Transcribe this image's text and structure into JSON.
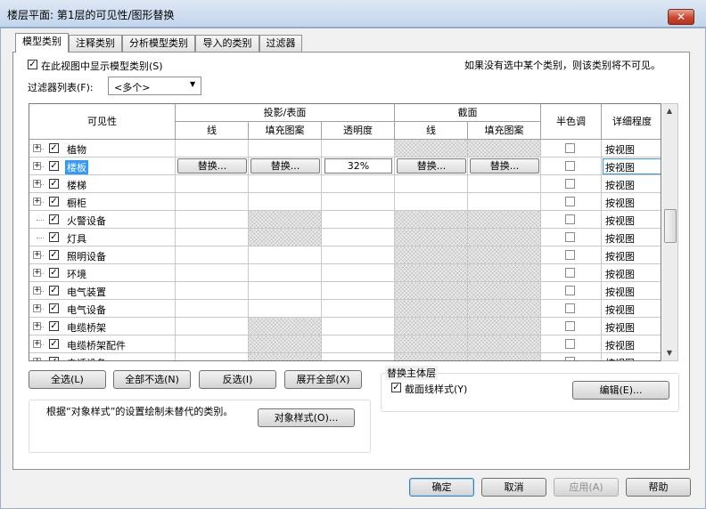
{
  "window": {
    "title": "楼层平面: 第1层的可见性/图形替换",
    "close_glyph": "✕"
  },
  "tabs": [
    "模型类别",
    "注释类别",
    "分析模型类别",
    "导入的类别",
    "过滤器"
  ],
  "show_categories": {
    "label": "在此视图中显示模型类别(S)",
    "checked": true
  },
  "hint": "如果没有选中某个类别，则该类别将不可见。",
  "filter_list": {
    "label": "过滤器列表(F):",
    "value": "<多个>"
  },
  "columns": {
    "visibility": "可见性",
    "projection_group": "投影/表面",
    "projection_line": "线",
    "projection_pattern": "填充图案",
    "transparency": "透明度",
    "cut_group": "截面",
    "cut_line": "线",
    "cut_pattern": "填充图案",
    "halftone": "半色调",
    "detail_level": "详细程度"
  },
  "rows": [
    {
      "name": "植物",
      "checked": true,
      "expandable": true,
      "selected": false,
      "proj_line_hatched": false,
      "proj_pattern_hatched": false,
      "cut_line_hatched": true,
      "cut_pattern_hatched": true,
      "detail": "按视图"
    },
    {
      "name": "楼板",
      "checked": true,
      "expandable": true,
      "selected": true,
      "proj_line_hatched": false,
      "proj_pattern_hatched": false,
      "cut_line_hatched": false,
      "cut_pattern_hatched": false,
      "detail": "按视图",
      "override_label": "替换...",
      "transparency": "32%"
    },
    {
      "name": "楼梯",
      "checked": true,
      "expandable": true,
      "selected": false,
      "proj_line_hatched": false,
      "proj_pattern_hatched": false,
      "cut_line_hatched": false,
      "cut_pattern_hatched": false,
      "detail": "按视图"
    },
    {
      "name": "橱柜",
      "checked": true,
      "expandable": true,
      "selected": false,
      "proj_line_hatched": false,
      "proj_pattern_hatched": false,
      "cut_line_hatched": false,
      "cut_pattern_hatched": false,
      "detail": "按视图"
    },
    {
      "name": "火警设备",
      "checked": true,
      "expandable": false,
      "selected": false,
      "proj_line_hatched": false,
      "proj_pattern_hatched": true,
      "cut_line_hatched": true,
      "cut_pattern_hatched": true,
      "detail": "按视图"
    },
    {
      "name": "灯具",
      "checked": true,
      "expandable": false,
      "selected": false,
      "proj_line_hatched": false,
      "proj_pattern_hatched": true,
      "cut_line_hatched": true,
      "cut_pattern_hatched": true,
      "detail": "按视图"
    },
    {
      "name": "照明设备",
      "checked": true,
      "expandable": true,
      "selected": false,
      "proj_line_hatched": false,
      "proj_pattern_hatched": false,
      "cut_line_hatched": true,
      "cut_pattern_hatched": true,
      "detail": "按视图"
    },
    {
      "name": "环境",
      "checked": true,
      "expandable": true,
      "selected": false,
      "proj_line_hatched": false,
      "proj_pattern_hatched": false,
      "cut_line_hatched": true,
      "cut_pattern_hatched": true,
      "detail": "按视图"
    },
    {
      "name": "电气装置",
      "checked": true,
      "expandable": true,
      "selected": false,
      "proj_line_hatched": false,
      "proj_pattern_hatched": false,
      "cut_line_hatched": true,
      "cut_pattern_hatched": true,
      "detail": "按视图"
    },
    {
      "name": "电气设备",
      "checked": true,
      "expandable": true,
      "selected": false,
      "proj_line_hatched": false,
      "proj_pattern_hatched": false,
      "cut_line_hatched": true,
      "cut_pattern_hatched": true,
      "detail": "按视图"
    },
    {
      "name": "电缆桥架",
      "checked": true,
      "expandable": true,
      "selected": false,
      "proj_line_hatched": false,
      "proj_pattern_hatched": true,
      "cut_line_hatched": true,
      "cut_pattern_hatched": true,
      "detail": "按视图"
    },
    {
      "name": "电缆桥架配件",
      "checked": true,
      "expandable": true,
      "selected": false,
      "proj_line_hatched": false,
      "proj_pattern_hatched": true,
      "cut_line_hatched": true,
      "cut_pattern_hatched": true,
      "detail": "按视图"
    },
    {
      "name": "电话设备",
      "checked": true,
      "expandable": true,
      "selected": false,
      "proj_line_hatched": false,
      "proj_pattern_hatched": true,
      "cut_line_hatched": true,
      "cut_pattern_hatched": true,
      "detail": "按视图"
    }
  ],
  "list_buttons": [
    "全选(L)",
    "全部不选(N)",
    "反选(I)",
    "展开全部(X)"
  ],
  "override_host": {
    "legend": "替换主体层",
    "checkbox_label": "截面线样式(Y)",
    "checked": true,
    "edit_button": "编辑(E)..."
  },
  "object_styles": {
    "text": "根据“对象样式”的设置绘制未替代的类别。",
    "button": "对象样式(O)..."
  },
  "footer": {
    "ok": "确定",
    "cancel": "取消",
    "apply": "应用(A)",
    "help": "帮助"
  },
  "colors": {
    "selection": "#3399ff",
    "hatch": "#c9c9c9"
  },
  "icons": {
    "close": "close-icon",
    "dropdown": "dropdown-arrow-icon",
    "expand": "expand-plus-icon",
    "checkbox": "checkbox-icon"
  }
}
